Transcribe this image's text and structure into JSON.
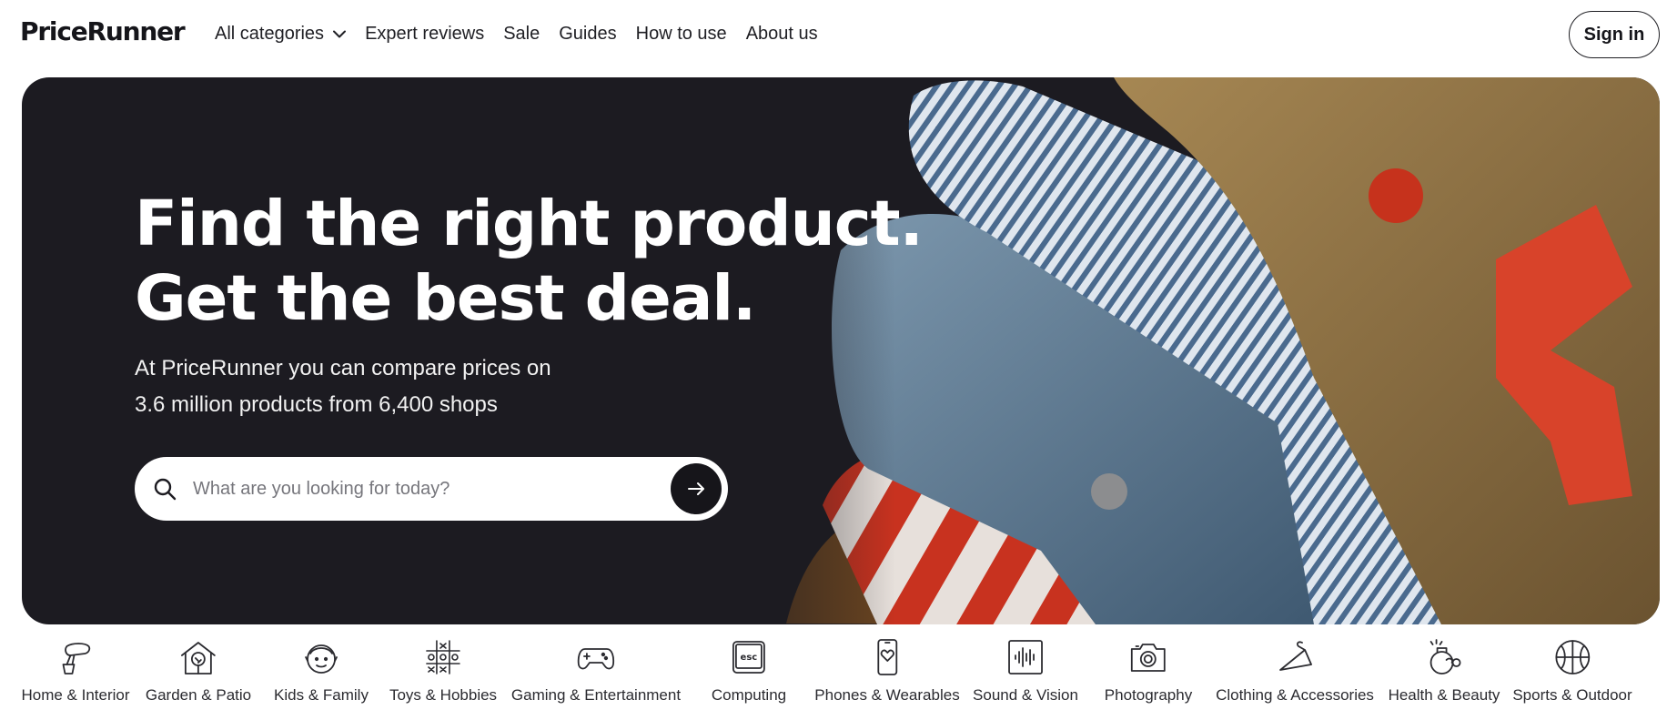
{
  "header": {
    "logo": "PriceRunner",
    "nav": [
      {
        "label": "All categories",
        "has_dropdown": true
      },
      {
        "label": "Expert reviews"
      },
      {
        "label": "Sale"
      },
      {
        "label": "Guides"
      },
      {
        "label": "How to use"
      },
      {
        "label": "About us"
      }
    ],
    "sign_in": "Sign in"
  },
  "hero": {
    "title_line1": "Find the right product.",
    "title_line2": "Get the best deal.",
    "subtitle_line1": "At PriceRunner you can compare prices on",
    "subtitle_line2": "3.6 million products from 6,400 shops",
    "search": {
      "placeholder": "What are you looking for today?",
      "value": ""
    },
    "background": "#1c1b21"
  },
  "categories": [
    {
      "label": "Home & Interior",
      "icon": "mixer-icon"
    },
    {
      "label": "Garden & Patio",
      "icon": "house-tree-icon"
    },
    {
      "label": "Kids & Family",
      "icon": "child-face-icon"
    },
    {
      "label": "Toys & Hobbies",
      "icon": "tic-tac-toe-icon"
    },
    {
      "label": "Gaming & Entertainment",
      "icon": "gamepad-icon"
    },
    {
      "label": "Computing",
      "icon": "esc-key-icon"
    },
    {
      "label": "Phones & Wearables",
      "icon": "phone-heart-icon"
    },
    {
      "label": "Sound & Vision",
      "icon": "soundwave-icon"
    },
    {
      "label": "Photography",
      "icon": "camera-icon"
    },
    {
      "label": "Clothing & Accessories",
      "icon": "hanger-icon"
    },
    {
      "label": "Health & Beauty",
      "icon": "perfume-icon"
    },
    {
      "label": "Sports & Outdoor",
      "icon": "basketball-icon"
    }
  ],
  "colors": {
    "text": "#1f1f24",
    "hero_dark": "#1c1b21",
    "accent_red": "#d8432a"
  }
}
